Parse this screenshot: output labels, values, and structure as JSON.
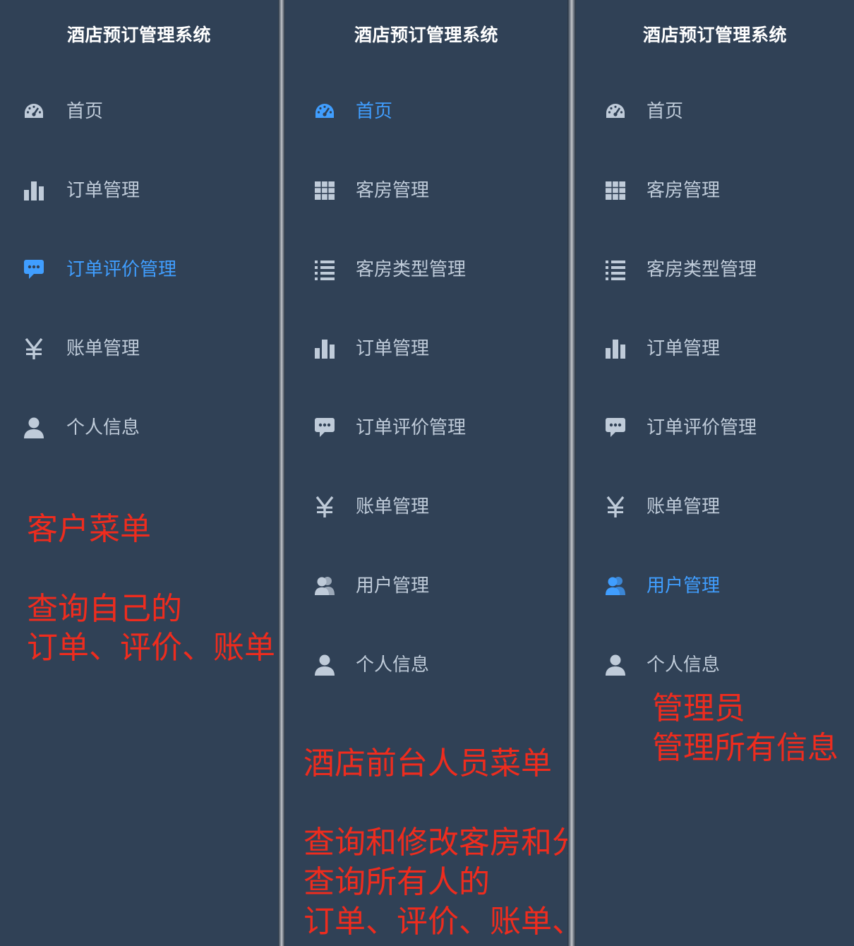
{
  "colors": {
    "sidebar_bg": "#304156",
    "text": "#bfcbd9",
    "active": "#409eff",
    "title": "#ffffff",
    "annotation": "#ee2c1e"
  },
  "panels": [
    {
      "role": "customer",
      "title": "酒店预订管理系统",
      "active_item": "订单评价管理",
      "menu": [
        {
          "label": "首页",
          "icon": "dashboard-icon"
        },
        {
          "label": "订单管理",
          "icon": "bar-chart-icon"
        },
        {
          "label": "订单评价管理",
          "icon": "comment-icon"
        },
        {
          "label": "账单管理",
          "icon": "yen-icon"
        },
        {
          "label": "个人信息",
          "icon": "user-icon"
        }
      ],
      "annotation": {
        "heading": "客户菜单",
        "lines": [
          "查询自己的",
          "订单、评价、账单"
        ]
      }
    },
    {
      "role": "front-desk",
      "title": "酒店预订管理系统",
      "active_item": "首页",
      "menu": [
        {
          "label": "首页",
          "icon": "dashboard-icon"
        },
        {
          "label": "客房管理",
          "icon": "grid-icon"
        },
        {
          "label": "客房类型管理",
          "icon": "list-icon"
        },
        {
          "label": "订单管理",
          "icon": "bar-chart-icon"
        },
        {
          "label": "订单评价管理",
          "icon": "comment-icon"
        },
        {
          "label": "账单管理",
          "icon": "yen-icon"
        },
        {
          "label": "用户管理",
          "icon": "users-icon"
        },
        {
          "label": "个人信息",
          "icon": "user-icon"
        }
      ],
      "annotation": {
        "heading": "酒店前台人员菜单",
        "lines": [
          "查询和修改客房和分类",
          "查询所有人的",
          "订单、评价、账单、用户信息"
        ]
      }
    },
    {
      "role": "admin",
      "title": "酒店预订管理系统",
      "active_item": "用户管理",
      "menu": [
        {
          "label": "首页",
          "icon": "dashboard-icon"
        },
        {
          "label": "客房管理",
          "icon": "grid-icon"
        },
        {
          "label": "客房类型管理",
          "icon": "list-icon"
        },
        {
          "label": "订单管理",
          "icon": "bar-chart-icon"
        },
        {
          "label": "订单评价管理",
          "icon": "comment-icon"
        },
        {
          "label": "账单管理",
          "icon": "yen-icon"
        },
        {
          "label": "用户管理",
          "icon": "users-icon"
        },
        {
          "label": "个人信息",
          "icon": "user-icon"
        }
      ],
      "annotation": {
        "lines": [
          "管理员",
          "管理所有信息"
        ]
      }
    }
  ]
}
